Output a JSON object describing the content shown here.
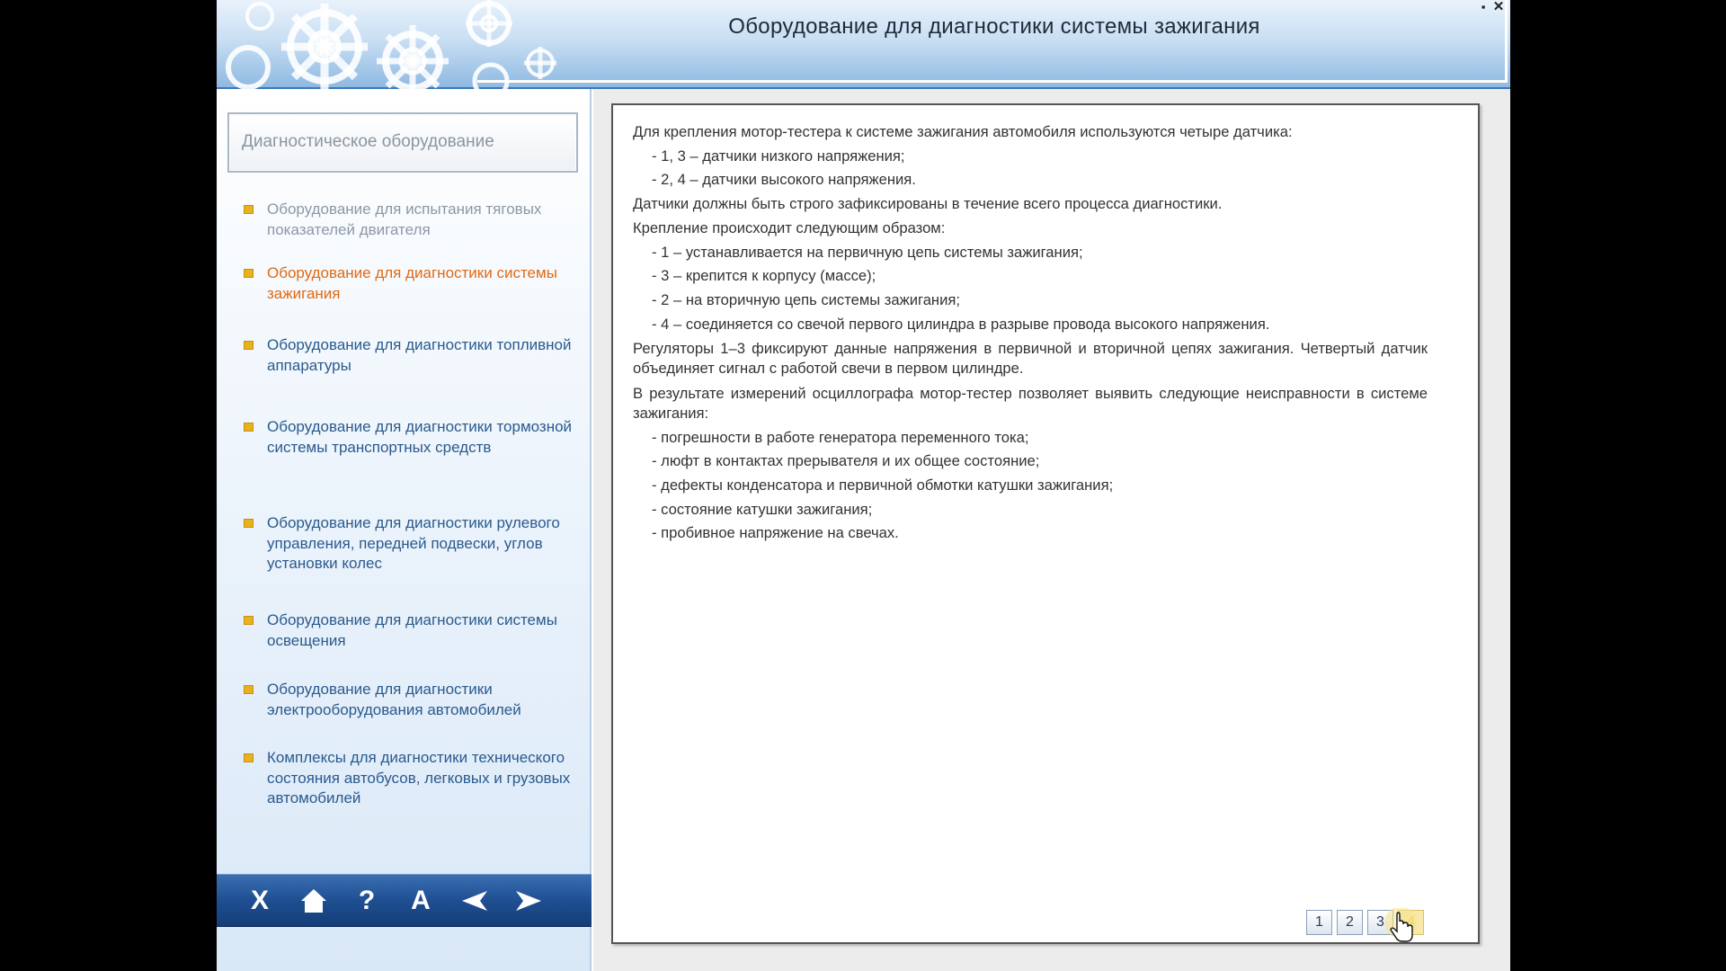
{
  "header": {
    "title": "Оборудование для диагностики системы зажигания",
    "minimize": "▪",
    "close": "✕"
  },
  "sidebar": {
    "section_title": "Диагностическое оборудование",
    "items": [
      {
        "label": "Оборудование для испытания тяговых показателей двигателя",
        "state": "muted"
      },
      {
        "label": "Оборудование для диагностики системы зажигания",
        "state": "active"
      },
      {
        "label": "Оборудование для диагностики топливной аппаратуры",
        "state": "normal"
      },
      {
        "label": "Оборудование для диагностики тормозной системы транспортных средств",
        "state": "normal"
      },
      {
        "label": "Оборудование для диагностики рулевого управления, передней подвески, углов установки колес",
        "state": "normal"
      },
      {
        "label": "Оборудование для диагностики системы освещения",
        "state": "normal"
      },
      {
        "label": "Оборудование для диагностики электрооборудования автомобилей",
        "state": "normal"
      },
      {
        "label": "Комплексы для диагностики технического состояния автобусов, легковых и грузовых автомобилей",
        "state": "normal"
      }
    ],
    "toolbar": {
      "exit": "X",
      "home": "home-icon",
      "help": "?",
      "font": "A",
      "back": "arrow-left-icon",
      "forward": "arrow-right-icon"
    }
  },
  "content": {
    "lines": [
      "Для крепления мотор-тестера к системе зажигания автомобиля используются четыре датчика:",
      "- 1, 3 – датчики низкого напряжения;",
      "- 2, 4 – датчики высокого напряжения.",
      "Датчики должны быть строго зафиксированы в течение всего процесса диагностики.",
      "Крепление происходит следующим образом:",
      "- 1 – устанавливается на первичную цепь системы зажигания;",
      "- 3 – крепится к корпусу (массе);",
      "- 2 – на вторичную цепь системы зажигания;",
      "- 4 – соединяется со свечой первого цилиндра в разрыве провода высокого напряжения.",
      "Регуляторы 1–3 фиксируют данные напряжения в первичной и вторичной цепях зажигания. Четвертый датчик объединяет сигнал с работой свечи в первом цилиндре.",
      "В результате измерений осциллографа мотор-тестер позволяет выявить следующие неисправности в системе зажигания:",
      "- погрешности в работе генератора переменного тока;",
      "- люфт в контактах прерывателя и их общее состояние;",
      "- дефекты конденсатора и первичной обмотки катушки зажигания;",
      "- состояние катушки зажигания;",
      "- пробивное напряжение на свечах."
    ],
    "pager": [
      "1",
      "2",
      "3",
      "4"
    ],
    "current_page": "4"
  },
  "colors": {
    "accent_orange": "#e06a12",
    "link_blue": "#2a5a8e",
    "bullet_yellow": "#e8b21a",
    "toolbar_blue": "#1f4f92"
  }
}
